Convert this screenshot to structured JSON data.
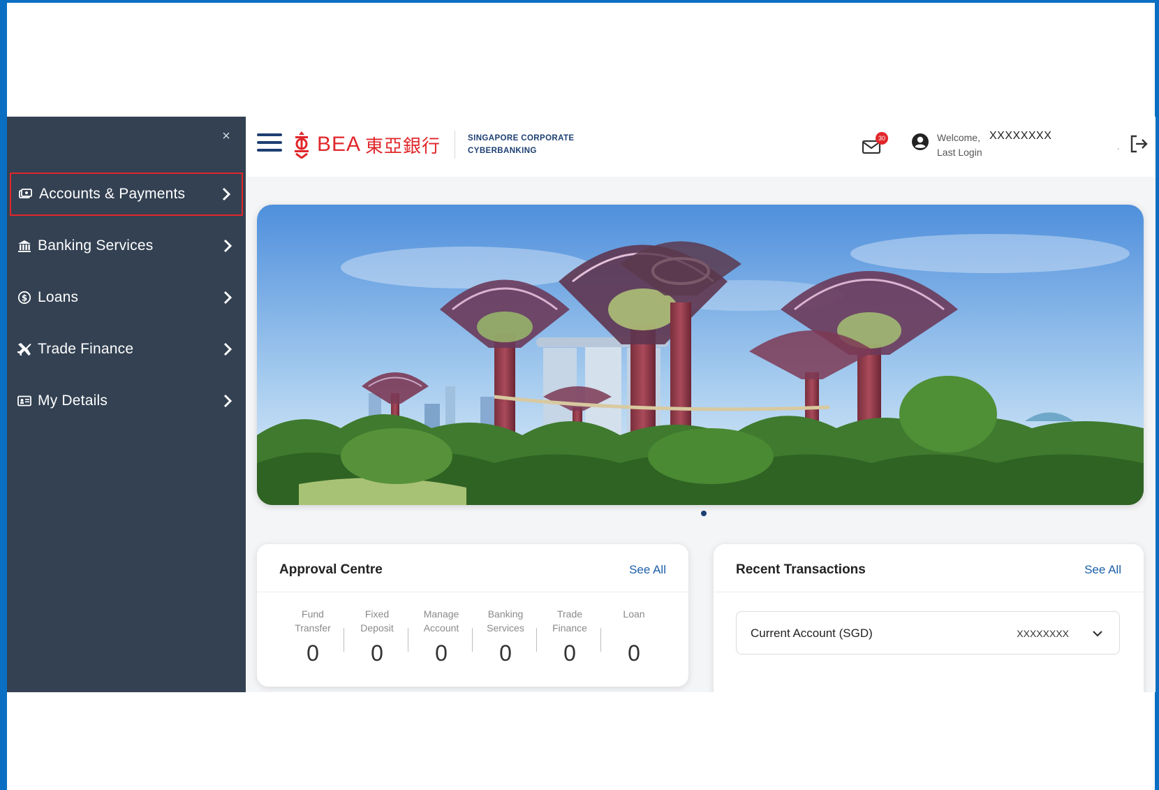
{
  "sidebar": {
    "close_label": "×",
    "items": [
      {
        "label": "Accounts & Payments",
        "icon": "money-icon",
        "active": true
      },
      {
        "label": "Banking Services",
        "icon": "bank-icon",
        "active": false
      },
      {
        "label": "Loans",
        "icon": "dollar-coin-icon",
        "active": false
      },
      {
        "label": "Trade Finance",
        "icon": "plane-icon",
        "active": false
      },
      {
        "label": "My Details",
        "icon": "id-card-icon",
        "active": false
      }
    ]
  },
  "header": {
    "brand": "BEA",
    "brand_zh": "東亞銀行",
    "subtitle_line1": "SINGAPORE CORPORATE",
    "subtitle_line2": "CYBERBANKING",
    "mail_badge": "30",
    "welcome_label": "Welcome,",
    "last_login_label": "Last Login",
    "username": "XXXXXXXX",
    "separator": "."
  },
  "approval_centre": {
    "title": "Approval Centre",
    "see_all": "See All",
    "metrics": [
      {
        "line1": "Fund",
        "line2": "Transfer",
        "value": "0"
      },
      {
        "line1": "Fixed",
        "line2": "Deposit",
        "value": "0"
      },
      {
        "line1": "Manage",
        "line2": "Account",
        "value": "0"
      },
      {
        "line1": "Banking",
        "line2": "Services",
        "value": "0"
      },
      {
        "line1": "Trade",
        "line2": "Finance",
        "value": "0"
      },
      {
        "line1": "Loan",
        "line2": "",
        "value": "0"
      }
    ]
  },
  "recent_transactions": {
    "title": "Recent Transactions",
    "see_all": "See All",
    "account_name": "Current Account (SGD)",
    "account_number": "XXXXXXXX"
  },
  "colors": {
    "sidebar_bg": "#334152",
    "brand_red": "#e0272b",
    "navy": "#1d3f72",
    "frame_blue": "#0a6fc2"
  }
}
